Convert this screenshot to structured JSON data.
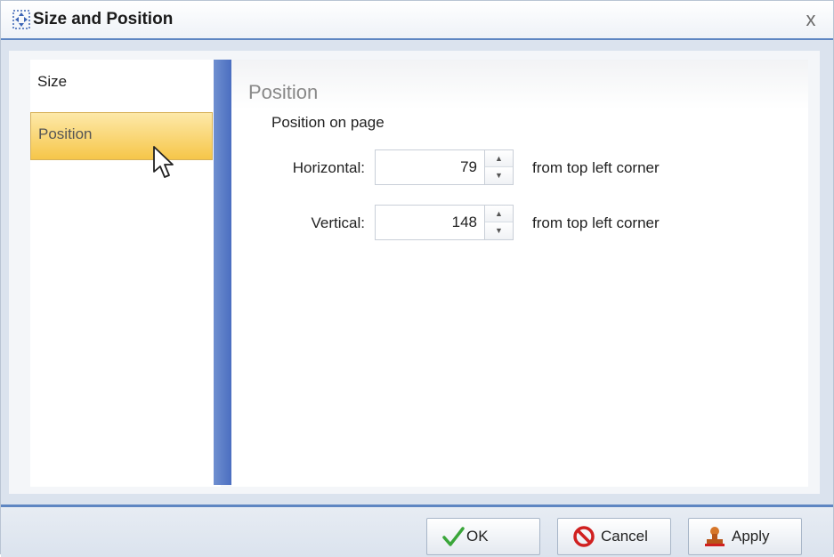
{
  "dialog": {
    "title": "Size and Position",
    "close_label": "x"
  },
  "nav": {
    "items": [
      {
        "label": "Size",
        "selected": false
      },
      {
        "label": "Position",
        "selected": true
      }
    ]
  },
  "panel": {
    "title": "Position",
    "group_label": "Position on page",
    "fields": [
      {
        "label": "Horizontal:",
        "value": "79",
        "suffix": "from top left corner"
      },
      {
        "label": "Vertical:",
        "value": "148",
        "suffix": "from top left corner"
      }
    ]
  },
  "buttons": {
    "ok": "OK",
    "cancel": "Cancel",
    "apply": "Apply"
  },
  "colors": {
    "accent": "#5e86c2",
    "selection": "#f6c649",
    "splitter": "#4b6ec0"
  }
}
